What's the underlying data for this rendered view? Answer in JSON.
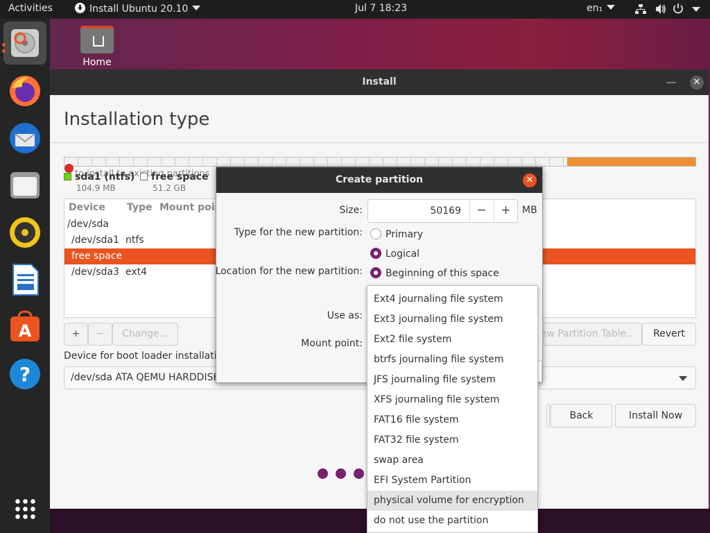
{
  "topbar": {
    "activities": "Activities",
    "app_title": "Install Ubuntu 20.10",
    "clock": "Jul 7  18:23",
    "lang": "en₁"
  },
  "desktop": {
    "home_label": "Home"
  },
  "dock": {
    "icons": [
      "installer-icon",
      "firefox-icon",
      "thunderbird-icon",
      "files-icon",
      "rhythmbox-icon",
      "libreoffice-writer-icon",
      "ubuntu-software-icon",
      "help-icon",
      "show-applications-icon"
    ]
  },
  "window": {
    "title": "Install",
    "heading": "Installation type",
    "ghost_text": "to install to existing partitions",
    "legend": [
      {
        "name": "sda1 (ntfs)",
        "size": "104.9 MB",
        "color": "#73d216"
      },
      {
        "name": "free space",
        "size": "51.2 GB",
        "color": "#ffffff"
      }
    ],
    "table": {
      "headers": [
        "Device",
        "Type",
        "Mount point"
      ],
      "rows": [
        {
          "device": "/dev/sda",
          "type": ""
        },
        {
          "device": "/dev/sda1",
          "type": "ntfs"
        },
        {
          "device": "free space",
          "type": "",
          "selected": true
        },
        {
          "device": "/dev/sda3",
          "type": "ext4"
        }
      ]
    },
    "buttons": {
      "add": "+",
      "remove": "−",
      "change": "Change...",
      "new_table": "New Partition Table...",
      "revert": "Revert",
      "back": "Back",
      "install_now": "Install Now"
    },
    "boot_label": "Device for boot loader installation:",
    "boot_device": "/dev/sda    ATA QEMU HARDDISK (51.3 GB)"
  },
  "dialog": {
    "title": "Create partition",
    "size_label": "Size:",
    "size_value": "50169",
    "size_unit": "MB",
    "minus": "−",
    "plus": "+",
    "type_label": "Type for the new partition:",
    "type_options": [
      "Primary",
      "Logical"
    ],
    "type_selected": "Logical",
    "location_label": "Location for the new partition:",
    "location_options": [
      "Beginning of this space"
    ],
    "use_as_label": "Use as:",
    "mount_label": "Mount point:"
  },
  "dropdown": {
    "options": [
      "Ext4 journaling file system",
      "Ext3 journaling file system",
      "Ext2 file system",
      "btrfs journaling file system",
      "JFS journaling file system",
      "XFS journaling file system",
      "FAT16 file system",
      "FAT32 file system",
      "swap area",
      "EFI System Partition",
      "physical volume for encryption",
      "do not use the partition"
    ],
    "highlighted": "physical volume for encryption"
  },
  "colors": {
    "accent": "#e95420",
    "radio": "#77216f",
    "dark": "#2f2f2f"
  }
}
